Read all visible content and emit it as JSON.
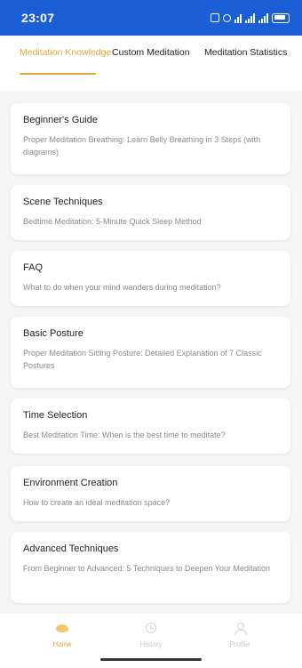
{
  "status": {
    "time": "23:07"
  },
  "tabs": [
    {
      "label": "Meditation Knowledge",
      "active": true
    },
    {
      "label": "Custom Meditation",
      "active": false
    },
    {
      "label": "Meditation Statistics",
      "active": false
    }
  ],
  "cards": [
    {
      "title": "Beginner's Guide",
      "desc": "Proper Meditation Breathing: Learn Belly Breathing in 3 Steps (with diagrams)"
    },
    {
      "title": "Scene Techniques",
      "desc": "Bedtime Meditation: 5-Minute Quick Sleep Method"
    },
    {
      "title": "FAQ",
      "desc": "What to do when your mind wanders during meditation?"
    },
    {
      "title": "Basic Posture",
      "desc": "Proper Meditation Sitting Posture: Detailed Explanation of 7 Classic Postures"
    },
    {
      "title": "Time Selection",
      "desc": "Best Meditation Time: When is the best time to meditate?"
    },
    {
      "title": "Environment Creation",
      "desc": "How to create an ideal meditation space?"
    },
    {
      "title": "Advanced Techniques",
      "desc": "From Beginner to Advanced: 5 Techniques to Deepen Your Meditation"
    }
  ],
  "nav": [
    {
      "label": "Home",
      "icon": "home-icon",
      "active": true
    },
    {
      "label": "History",
      "icon": "history-icon",
      "active": false
    },
    {
      "label": "Profile",
      "icon": "profile-icon",
      "active": false
    }
  ],
  "colors": {
    "accent": "#e3a83a",
    "status_bar": "#1a5fd6",
    "background": "#f5f5f5"
  }
}
